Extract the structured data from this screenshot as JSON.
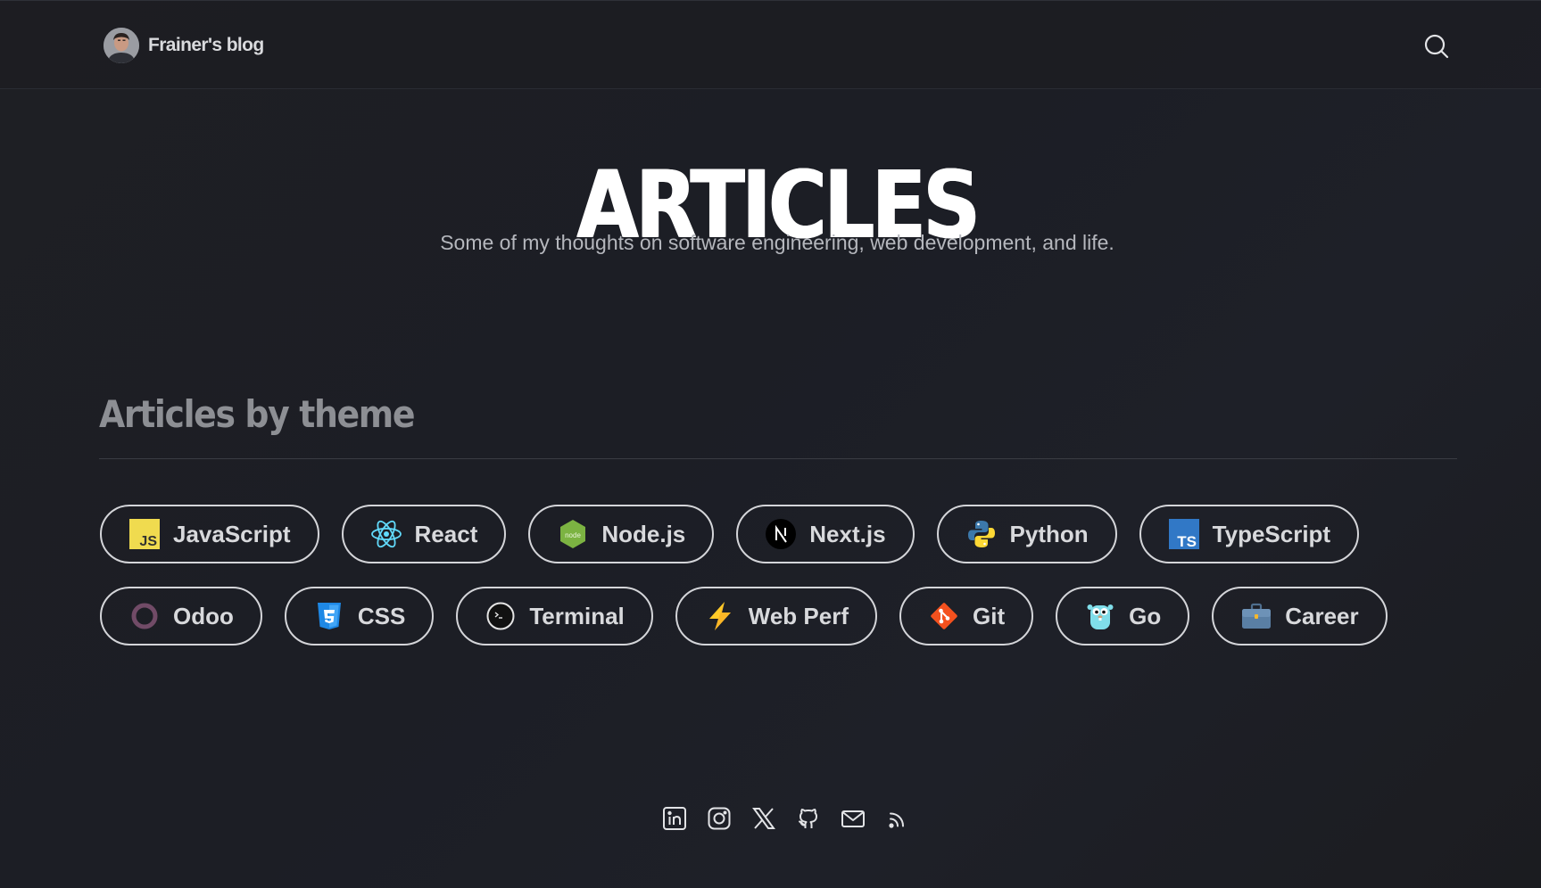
{
  "header": {
    "brand_name": "Frainer's blog",
    "avatar_icon": "avatar",
    "search_icon": "search-icon"
  },
  "hero": {
    "title": "ARTICLES",
    "subtitle": "Some of my thoughts on software engineering, web development, and life."
  },
  "themes": {
    "heading": "Articles by theme",
    "rows": [
      [
        {
          "label": "JavaScript",
          "icon": "javascript-icon"
        },
        {
          "label": "React",
          "icon": "react-icon"
        },
        {
          "label": "Node.js",
          "icon": "nodejs-icon"
        },
        {
          "label": "Next.js",
          "icon": "nextjs-icon"
        },
        {
          "label": "Python",
          "icon": "python-icon"
        },
        {
          "label": "TypeScript",
          "icon": "typescript-icon"
        }
      ],
      [
        {
          "label": "Odoo",
          "icon": "odoo-icon"
        },
        {
          "label": "CSS",
          "icon": "css-icon"
        },
        {
          "label": "Terminal",
          "icon": "terminal-icon"
        },
        {
          "label": "Web Perf",
          "icon": "lightning-icon"
        },
        {
          "label": "Git",
          "icon": "git-icon"
        },
        {
          "label": "Go",
          "icon": "gopher-icon"
        },
        {
          "label": "Career",
          "icon": "briefcase-icon"
        }
      ]
    ]
  },
  "footer": {
    "socials": [
      "linkedin-icon",
      "instagram-icon",
      "x-icon",
      "github-icon",
      "mail-icon",
      "rss-icon"
    ]
  },
  "colors": {
    "background": "#1c1d22",
    "text": "#e6e6e8",
    "muted": "#8d8f94",
    "chip_border": "#d4d5d9"
  }
}
